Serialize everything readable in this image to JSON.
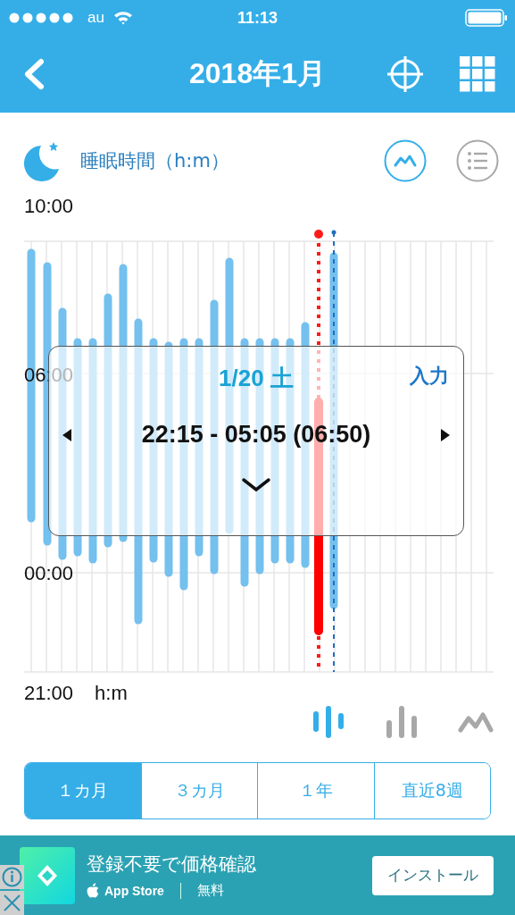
{
  "status_bar": {
    "carrier": "au",
    "time": "11:13"
  },
  "nav": {
    "title": "2018年1月"
  },
  "section": {
    "title": "睡眠時間（h:m）",
    "views": [
      {
        "kind": "graph",
        "selected": true
      },
      {
        "kind": "list",
        "selected": false
      }
    ]
  },
  "chart": {
    "y_labels": [
      "10:00",
      "06:00",
      "00:00",
      "21:00"
    ],
    "unit": "h:m"
  },
  "popup": {
    "date": "1/20 土",
    "action": "入力",
    "range": "22:15 - 05:05 (06:50)"
  },
  "chart_styles": [
    {
      "kind": "strip",
      "selected": true
    },
    {
      "kind": "bars",
      "selected": false
    },
    {
      "kind": "line",
      "selected": false
    }
  ],
  "periods": [
    {
      "label": "１カ月",
      "selected": true
    },
    {
      "label": "３カ月",
      "selected": false
    },
    {
      "label": "１年",
      "selected": false
    },
    {
      "label": "直近8週",
      "selected": false
    }
  ],
  "ad": {
    "headline": "登録不要で価格確認",
    "store": "App Store",
    "price": "無料",
    "button": "インストール"
  }
}
